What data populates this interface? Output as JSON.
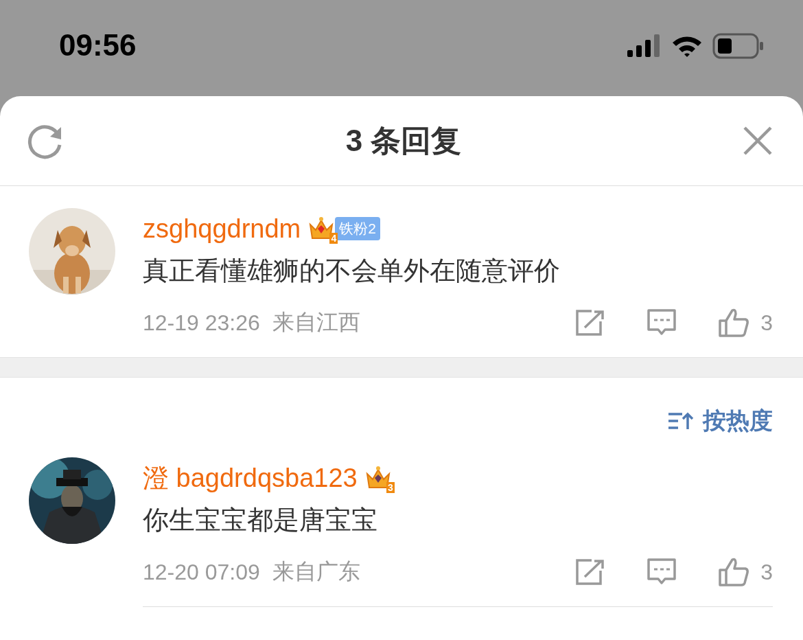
{
  "status_bar": {
    "time": "09:56"
  },
  "sheet": {
    "title": "3 条回复"
  },
  "comments": [
    {
      "username": "zsghqgdrndm",
      "crown_level": "4",
      "fan_badge": "铁粉2",
      "text": "真正看懂雄狮的不会单外在随意评价",
      "time": "12-19 23:26",
      "location": "来自江西",
      "likes": "3"
    },
    {
      "username": "澄 bagdrdqsba123",
      "crown_level": "3",
      "text": "你生宝宝都是唐宝宝",
      "time": "12-20 07:09",
      "location": "来自广东",
      "likes": "3"
    }
  ],
  "sort": {
    "label": "按热度"
  }
}
